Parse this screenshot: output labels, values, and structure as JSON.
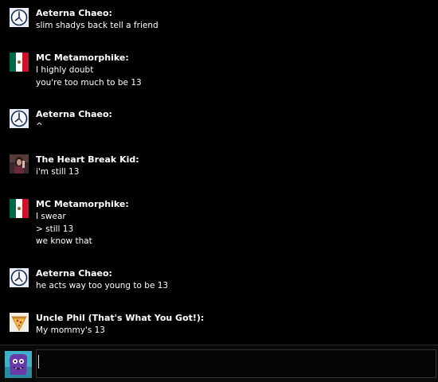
{
  "messages": [
    {
      "sender": "Aeterna Chaeo:",
      "avatar": "clock-icon",
      "lines": [
        "slim shadys back tell a friend"
      ]
    },
    {
      "sender": "MC Metamorphike:",
      "avatar": "mexico-flag-icon",
      "lines": [
        "I highly doubt",
        "you're too much to be 13"
      ]
    },
    {
      "sender": "Aeterna Chaeo:",
      "avatar": "clock-icon",
      "lines": [
        "^"
      ]
    },
    {
      "sender": "The Heart Break Kid:",
      "avatar": "person-photo-avatar",
      "lines": [
        "i'm still 13"
      ]
    },
    {
      "sender": "MC Metamorphike:",
      "avatar": "mexico-flag-icon",
      "lines": [
        "I swear",
        "> still 13",
        "we know that"
      ]
    },
    {
      "sender": "Aeterna Chaeo:",
      "avatar": "clock-icon",
      "lines": [
        "he acts way too young to be 13"
      ]
    },
    {
      "sender": "Uncle Phil (That's What You Got!):",
      "avatar": "pizza-slice-icon",
      "lines": [
        "My mommy's 13"
      ]
    }
  ],
  "composer": {
    "value": "",
    "avatar": "purple-monster-avatar"
  }
}
